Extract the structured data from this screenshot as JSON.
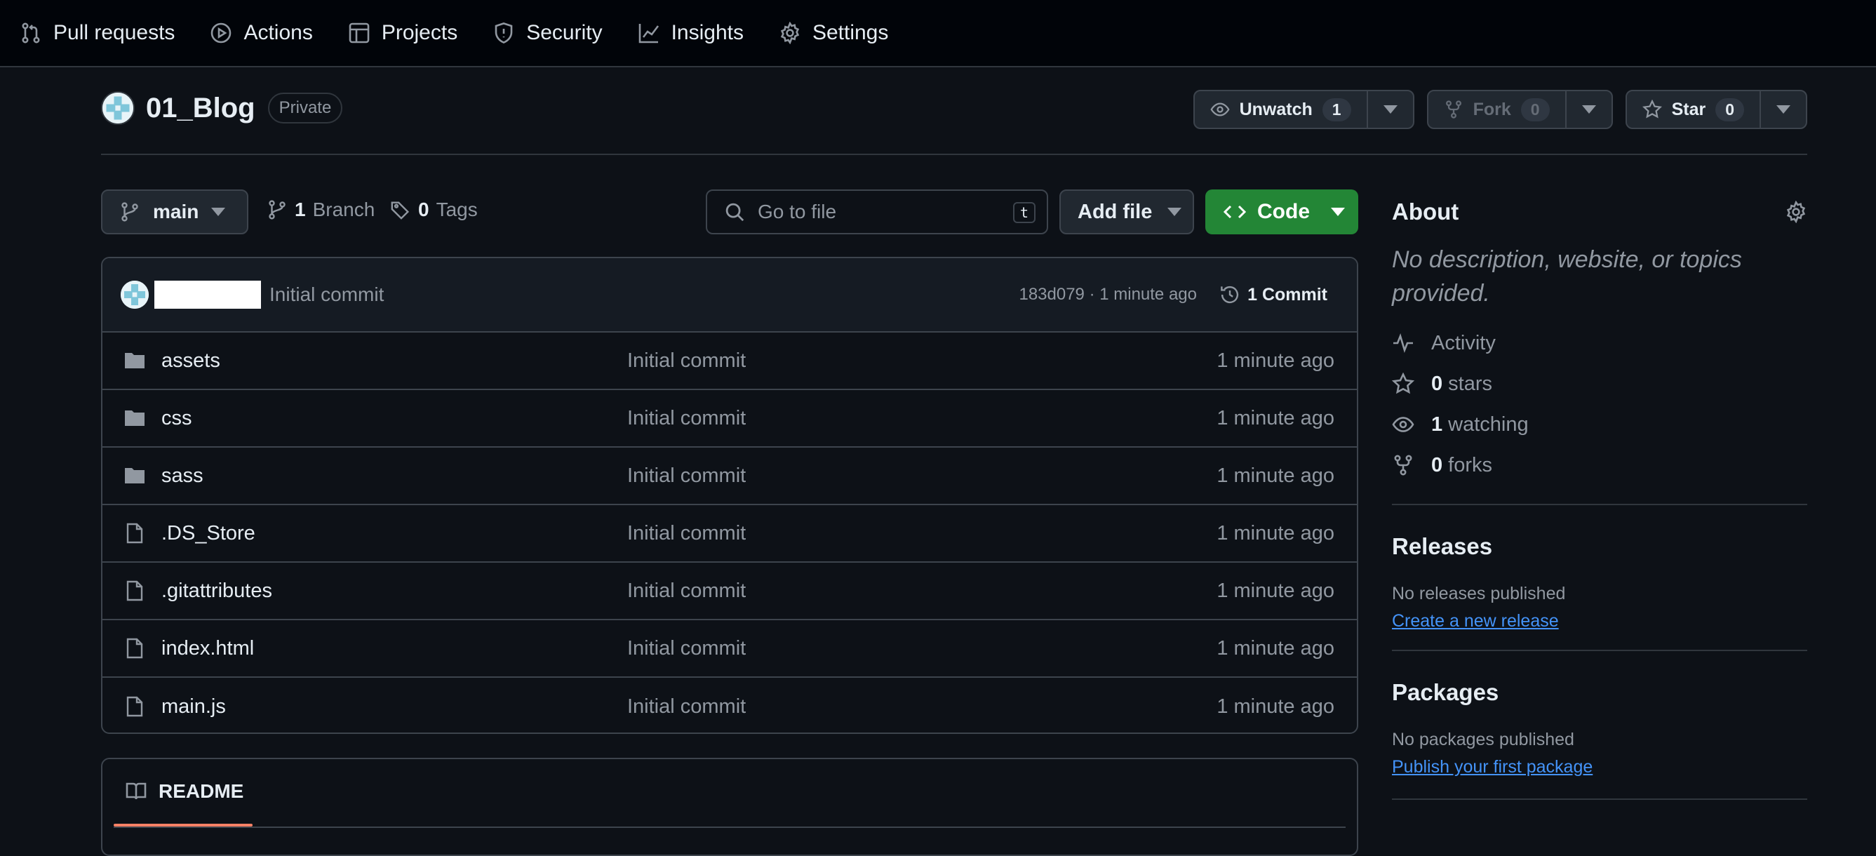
{
  "nav": {
    "items": [
      {
        "label": "Pull requests",
        "icon": "pull-request-icon"
      },
      {
        "label": "Actions",
        "icon": "play-icon"
      },
      {
        "label": "Projects",
        "icon": "table-icon"
      },
      {
        "label": "Security",
        "icon": "shield-icon"
      },
      {
        "label": "Insights",
        "icon": "graph-icon"
      },
      {
        "label": "Settings",
        "icon": "gear-icon"
      }
    ]
  },
  "repo": {
    "name": "01_Blog",
    "visibility": "Private"
  },
  "actions": {
    "watch_label": "Unwatch",
    "watch_count": "1",
    "fork_label": "Fork",
    "fork_count": "0",
    "star_label": "Star",
    "star_count": "0"
  },
  "toolbar": {
    "branch": "main",
    "branch_count": "1",
    "branch_label": "Branch",
    "tag_count": "0",
    "tag_label": "Tags",
    "search_placeholder": "Go to file",
    "search_shortcut": "t",
    "add_file_label": "Add file",
    "code_label": "Code"
  },
  "latest_commit": {
    "message": "Initial commit",
    "meta": "183d079 · 1 minute ago",
    "commit_count_label": "1 Commit"
  },
  "files": [
    {
      "name": "assets",
      "type": "folder",
      "message": "Initial commit",
      "time": "1 minute ago"
    },
    {
      "name": "css",
      "type": "folder",
      "message": "Initial commit",
      "time": "1 minute ago"
    },
    {
      "name": "sass",
      "type": "folder",
      "message": "Initial commit",
      "time": "1 minute ago"
    },
    {
      "name": ".DS_Store",
      "type": "file",
      "message": "Initial commit",
      "time": "1 minute ago"
    },
    {
      "name": ".gitattributes",
      "type": "file",
      "message": "Initial commit",
      "time": "1 minute ago"
    },
    {
      "name": "index.html",
      "type": "file",
      "message": "Initial commit",
      "time": "1 minute ago"
    },
    {
      "name": "main.js",
      "type": "file",
      "message": "Initial commit",
      "time": "1 minute ago"
    }
  ],
  "readme": {
    "tab_label": "README"
  },
  "about": {
    "title": "About",
    "description": "No description, website, or topics provided.",
    "activity_label": "Activity",
    "stars_count": "0",
    "stars_label": "stars",
    "watching_count": "1",
    "watching_label": "watching",
    "forks_count": "0",
    "forks_label": "forks"
  },
  "releases": {
    "title": "Releases",
    "note": "No releases published",
    "link": "Create a new release"
  },
  "packages": {
    "title": "Packages",
    "note": "No packages published",
    "link": "Publish your first package"
  },
  "colors": {
    "background": "#0d1117",
    "nav_background": "#010409",
    "accent_green": "#238636",
    "link_blue": "#4493f8",
    "tab_underline": "#f78166"
  }
}
